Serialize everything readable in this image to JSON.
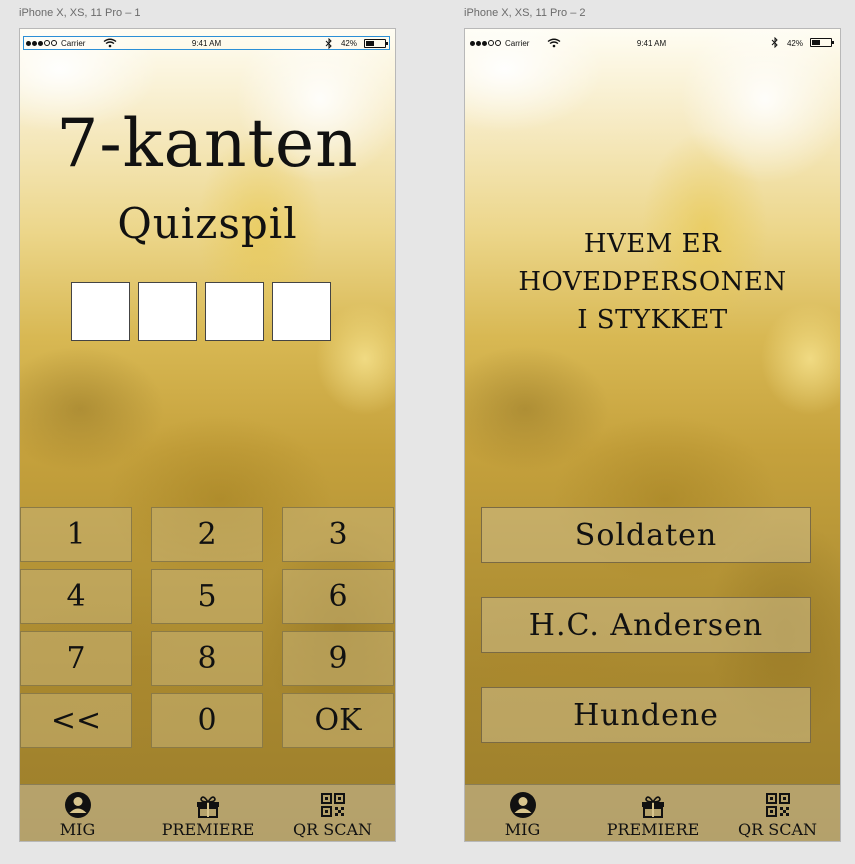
{
  "artboards": [
    {
      "label": "iPhone X, XS, 11 Pro – 1"
    },
    {
      "label": "iPhone X, XS, 11 Pro – 2"
    }
  ],
  "statusbar": {
    "carrier": "Carrier",
    "time": "9:41 AM",
    "battery": "42%"
  },
  "screen1": {
    "title": "7-kanten",
    "subtitle": "Quizspil",
    "code_box_count": 4,
    "keys": [
      "1",
      "2",
      "3",
      "4",
      "5",
      "6",
      "7",
      "8",
      "9",
      "<<",
      "0",
      "OK"
    ]
  },
  "screen2": {
    "question_line1": "HVEM ER HOVEDPERSONEN",
    "question_line2": "I STYKKET",
    "answers": [
      "Soldaten",
      "H.C. Andersen",
      "Hundene"
    ]
  },
  "tabbar": {
    "items": [
      {
        "label": "MIG",
        "icon": "user-icon"
      },
      {
        "label": "PREMIERE",
        "icon": "gift-icon"
      },
      {
        "label": "QR SCAN",
        "icon": "qr-code-icon"
      }
    ]
  },
  "colors": {
    "background": "#e6e6e6",
    "gold_dark": "#9c7e2b",
    "gold_light": "#f6eac2",
    "text": "#111111"
  }
}
